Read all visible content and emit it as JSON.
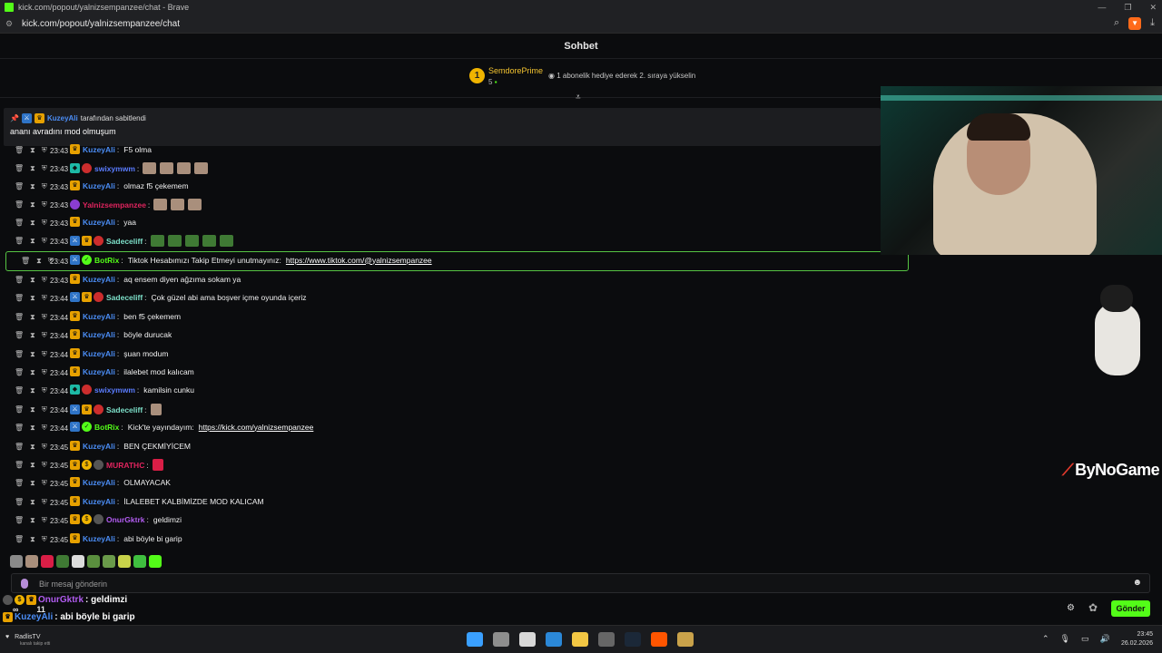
{
  "browser": {
    "title": "kick.com/popout/yalnizsempanzee/chat - Brave",
    "url": "kick.com/popout/yalnizsempanzee/chat",
    "window_controls": [
      "—",
      "❐",
      "✕"
    ]
  },
  "header": {
    "title": "Sohbet"
  },
  "top_gifter": {
    "rank": "1",
    "username": "SemdorePrime",
    "count": "5",
    "hint": "1 abonelik hediye ederek 2. sıraya yükselin"
  },
  "pinned": {
    "pinned_by": "KuzeyAli",
    "pinned_suffix": "tarafından sabitlendi",
    "message": "ananı avradını mod olmuşum"
  },
  "messages": [
    {
      "time": "23:43",
      "user": "KuzeyAli",
      "color": "#4b8df5",
      "text": "F5 olma"
    },
    {
      "time": "23:43",
      "user": "swixymwm",
      "color": "#5a7cff",
      "text": ""
    },
    {
      "time": "23:43",
      "user": "KuzeyAli",
      "color": "#4b8df5",
      "text": "olmaz f5 çekemem"
    },
    {
      "time": "23:43",
      "user": "Yalnizsempanzee",
      "color": "#e0245e",
      "text": ""
    },
    {
      "time": "23:43",
      "user": "KuzeyAli",
      "color": "#4b8df5",
      "text": "yaa"
    },
    {
      "time": "23:43",
      "user": "Sadeceliff",
      "color": "#7de0c9",
      "text": ""
    },
    {
      "time": "23:43",
      "user": "BotRix",
      "color": "#53fc18",
      "text": "Tiktok Hesabımızı Takip Etmeyi unutmayınız:",
      "link": "https://www.tiktok.com/@yalnizsempanzee"
    },
    {
      "time": "23:43",
      "user": "KuzeyAli",
      "color": "#4b8df5",
      "text": "aq ensem diyen ağzıma sokam ya"
    },
    {
      "time": "23:44",
      "user": "Sadeceliff",
      "color": "#7de0c9",
      "text": "Çok güzel abi ama boşver içme oyunda içeriz"
    },
    {
      "time": "23:44",
      "user": "KuzeyAli",
      "color": "#4b8df5",
      "text": "ben f5 çekemem"
    },
    {
      "time": "23:44",
      "user": "KuzeyAli",
      "color": "#4b8df5",
      "text": "böyle durucak"
    },
    {
      "time": "23:44",
      "user": "KuzeyAli",
      "color": "#4b8df5",
      "text": "şuan modum"
    },
    {
      "time": "23:44",
      "user": "KuzeyAli",
      "color": "#4b8df5",
      "text": "ilalebet mod kalıcam"
    },
    {
      "time": "23:44",
      "user": "swixymwm",
      "color": "#5a7cff",
      "text": "kamilsin cunku"
    },
    {
      "time": "23:44",
      "user": "Sadeceliff",
      "color": "#7de0c9",
      "text": ""
    },
    {
      "time": "23:44",
      "user": "BotRix",
      "color": "#53fc18",
      "text": "Kick'te yayındayım:",
      "link": "https://kick.com/yalnizsempanzee"
    },
    {
      "time": "23:45",
      "user": "KuzeyAli",
      "color": "#4b8df5",
      "text": "BEN ÇEKMİYİCEM"
    },
    {
      "time": "23:45",
      "user": "MURATHC",
      "color": "#e0245e",
      "text": ""
    },
    {
      "time": "23:45",
      "user": "KuzeyAli",
      "color": "#4b8df5",
      "text": "OLMAYACAK"
    },
    {
      "time": "23:45",
      "user": "KuzeyAli",
      "color": "#4b8df5",
      "text": "İLALEBET KALBİMİZDE MOD KALICAM"
    },
    {
      "time": "23:45",
      "user": "OnurGktrk",
      "color": "#b15cf0",
      "text": "geldimzi"
    },
    {
      "time": "23:45",
      "user": "KuzeyAli",
      "color": "#4b8df5",
      "text": "abi böyle bi garip"
    }
  ],
  "input": {
    "placeholder": "Bir mesaj gönderin"
  },
  "send_label": "Gönder",
  "overlay": {
    "line1_user": "OnurGktrk",
    "line1_text": ": geldimzi",
    "line2_user": "KuzeyAli",
    "line2_text": ": abi böyle bi garip",
    "viewer_icon": "∞",
    "count": "11"
  },
  "brand": "ByNoGame",
  "taskbar": {
    "account": "RadlisTV",
    "account_sub": "kanalı takip etti",
    "time": "23:45",
    "date": "26.02.2026"
  }
}
